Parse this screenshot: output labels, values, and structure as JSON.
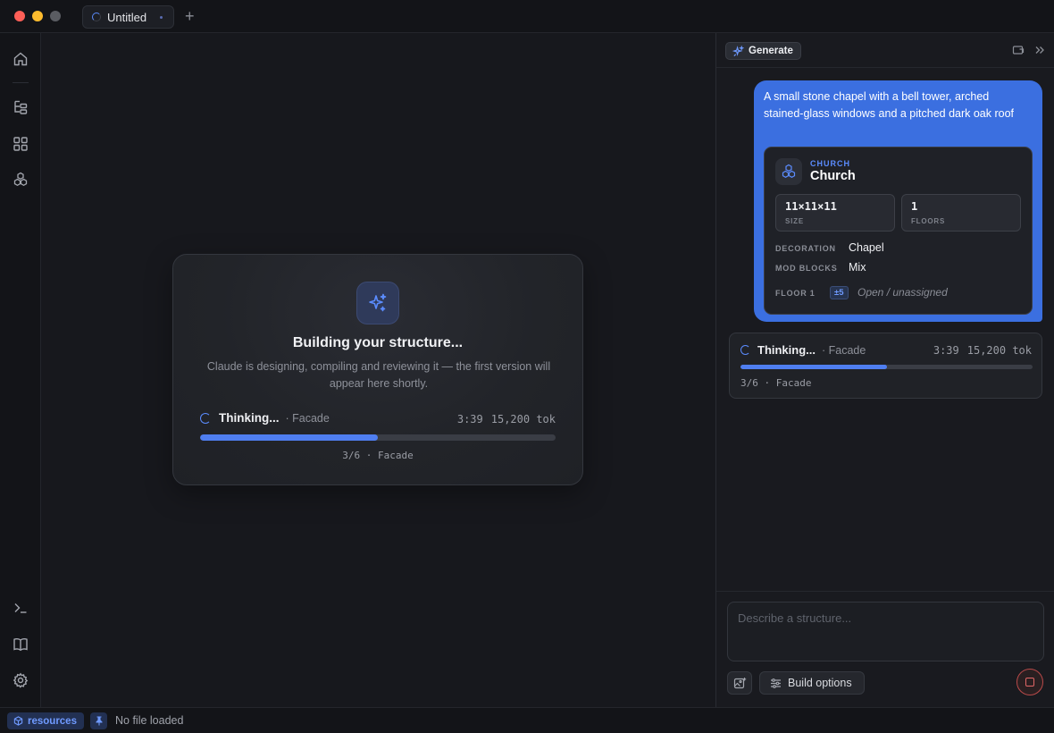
{
  "window": {
    "tab_title": "Untitled",
    "new_tab_label": "+"
  },
  "sidebar": {
    "items": [
      {
        "icon": "home-icon"
      },
      {
        "icon": "tree-icon"
      },
      {
        "icon": "grid-icon"
      },
      {
        "icon": "blocks-icon"
      },
      {
        "icon": "terminal-icon"
      },
      {
        "icon": "book-icon"
      },
      {
        "icon": "gear-icon"
      }
    ]
  },
  "main": {
    "build_card": {
      "title": "Building your structure...",
      "description": "Claude is designing, compiling and reviewing it — the first version will appear here shortly.",
      "status_label": "Thinking...",
      "status_sub": "· Facade",
      "elapsed": "3:39",
      "tokens": "15,200 tok",
      "progress": 0.5,
      "step_text": "3/6 · Facade"
    }
  },
  "panel": {
    "mode_label": "Generate",
    "user_message": "A small stone chapel with a bell tower, arched stained-glass windows and a pitched dark oak roof",
    "structure": {
      "kind": "CHURCH",
      "name": "Church",
      "size_value": "11×11×11",
      "size_label": "SIZE",
      "floors_value": "1",
      "floors_label": "FLOORS",
      "decoration_key": "DECORATION",
      "decoration_value": "Chapel",
      "mod_blocks_key": "MOD BLOCKS",
      "mod_blocks_value": "Mix",
      "floor_key": "FLOOR 1",
      "floor_badge": "±5",
      "floor_value": "Open / unassigned"
    },
    "thinking": {
      "status_label": "Thinking...",
      "status_sub": "· Facade",
      "elapsed": "3:39",
      "tokens": "15,200 tok",
      "progress": 0.5,
      "step_text": "3/6 · Facade"
    },
    "composer": {
      "placeholder": "Describe a structure...",
      "value": ""
    },
    "build_options_label": "Build options"
  },
  "statusbar": {
    "resources_label": "resources",
    "file_status": "No file loaded"
  },
  "colors": {
    "accent": "#4f7ef0",
    "user_bubble": "#3b6fe0",
    "stop": "#e06666"
  }
}
